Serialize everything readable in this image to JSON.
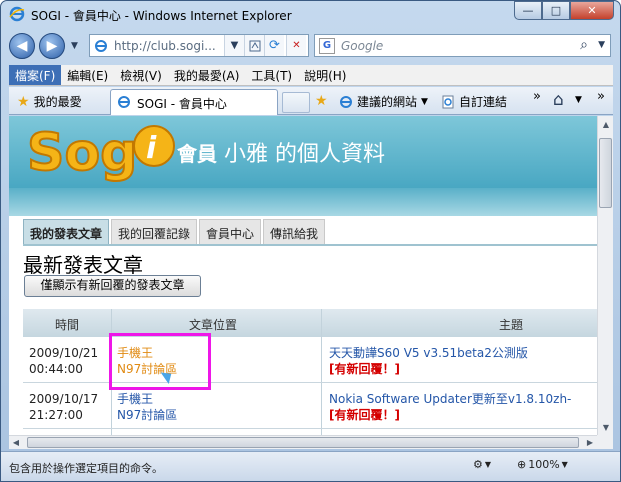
{
  "window": {
    "title": "SOGI - 會員中心 - Windows Internet Explorer",
    "min_glyph": "—",
    "max_glyph": "□",
    "close_glyph": "✕"
  },
  "nav": {
    "back_glyph": "◀",
    "forward_glyph": "▶",
    "dropdown_glyph": "▼",
    "address": "http://club.sogi...",
    "refresh_glyph": "⟳",
    "stop_glyph": "✕",
    "search_placeholder": "Google",
    "search_logo": "G",
    "search_glyph": "⌕"
  },
  "menubar": {
    "items": [
      "檔案(F)",
      "編輯(E)",
      "檢視(V)",
      "我的最愛(A)",
      "工具(T)",
      "說明(H)"
    ]
  },
  "favbar": {
    "favorites": "我的最愛",
    "tab_title": "SOGI - 會員中心",
    "suggested": "建議的網站",
    "custom_links": "自訂連結",
    "chevron": "»",
    "home_glyph": "⌂"
  },
  "page": {
    "banner_member": "會員",
    "banner_name": "小雅 的個人資料",
    "tabs": [
      "我的發表文章",
      "我的回覆記錄",
      "會員中心",
      "傳訊給我"
    ],
    "section_title": "最新發表文章",
    "filter_button": "僅顯示有新回覆的發表文章",
    "table": {
      "headers": [
        "時間",
        "文章位置",
        "主題"
      ],
      "rows": [
        {
          "date": "2009/10/21",
          "time": "00:44:00",
          "forum": "手機王",
          "board": "N97討論區",
          "topic": "天天動譁S60 V5 v3.51beta2公測版",
          "badge": "[有新回覆！]"
        },
        {
          "date": "2009/10/17",
          "time": "21:27:00",
          "forum": "手機王",
          "board": "N97討論區",
          "topic": "Nokia Software Updater更新至v1.8.10zh-",
          "badge": "[有新回覆！]"
        }
      ]
    }
  },
  "status": {
    "text": "包含用於操作選定項目的命令。",
    "zoom": "100%",
    "zoom_glyph": "⊕",
    "security_glyph": "⚙"
  },
  "colors": {
    "highlight": "#ee16e8",
    "forum_orange": "#e08a12",
    "link_blue": "#2456a8",
    "new_reply_red": "#d40000"
  }
}
